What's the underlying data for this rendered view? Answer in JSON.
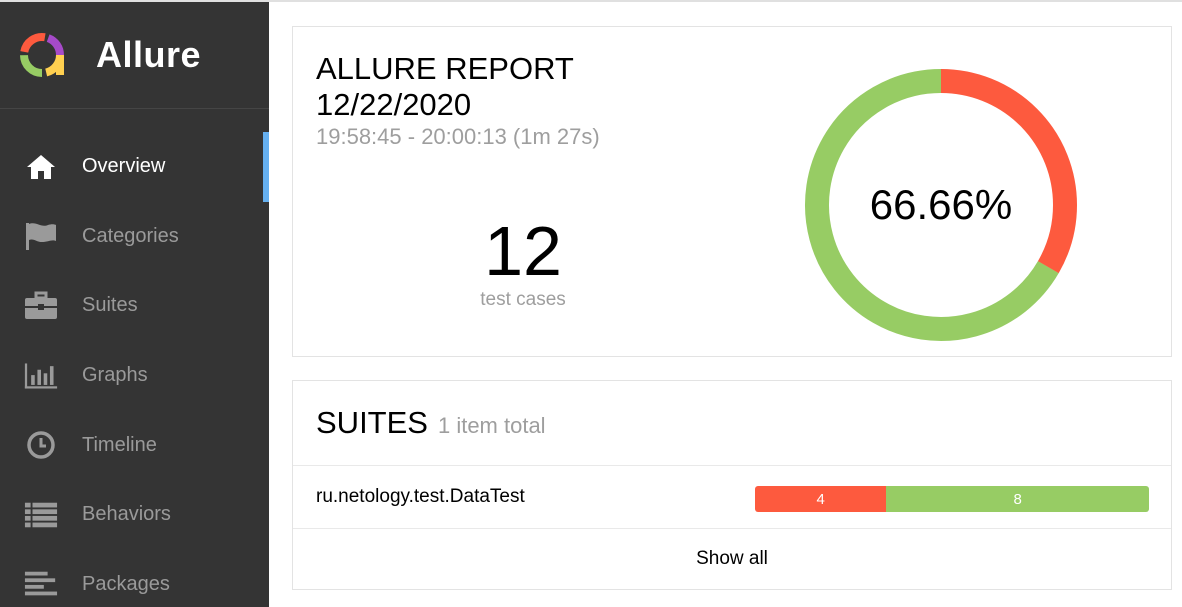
{
  "app": {
    "brand": "Allure"
  },
  "sidebar": {
    "items": [
      {
        "label": "Overview",
        "icon": "home-icon",
        "active": true
      },
      {
        "label": "Categories",
        "icon": "flag-icon",
        "active": false
      },
      {
        "label": "Suites",
        "icon": "briefcase-icon",
        "active": false
      },
      {
        "label": "Graphs",
        "icon": "bar-chart-icon",
        "active": false
      },
      {
        "label": "Timeline",
        "icon": "clock-icon",
        "active": false
      },
      {
        "label": "Behaviors",
        "icon": "list-icon",
        "active": false
      },
      {
        "label": "Packages",
        "icon": "align-left-icon",
        "active": false
      }
    ]
  },
  "summary": {
    "title": "ALLURE REPORT",
    "date": "12/22/2020",
    "time_range": "19:58:45 - 20:00:13 (1m 27s)",
    "test_count": "12",
    "test_count_label": "test cases",
    "pass_rate": "66.66%",
    "passed": 8,
    "failed": 4
  },
  "suites": {
    "title": "SUITES",
    "count_label": "1 item total",
    "rows": [
      {
        "name": "ru.netology.test.DataTest",
        "failed": "4",
        "passed": "8"
      }
    ],
    "show_all": "Show all"
  },
  "colors": {
    "failed": "#fd5a3e",
    "passed": "#97cc64",
    "sidebar_bg": "#343434",
    "accent": "#66b0f0"
  }
}
